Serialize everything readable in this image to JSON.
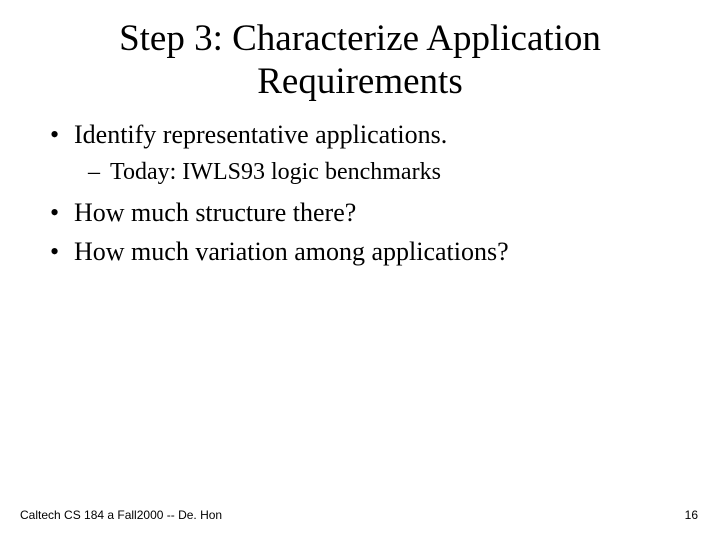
{
  "title": "Step 3: Characterize Application Requirements",
  "bullets": [
    {
      "text": "Identify representative applications.",
      "children": [
        {
          "text": "Today: IWLS93 logic benchmarks"
        }
      ]
    },
    {
      "text": "How much structure there?"
    },
    {
      "text": "How much variation among applications?"
    }
  ],
  "footer": {
    "left": "Caltech CS 184 a Fall2000 -- De. Hon",
    "right": "16"
  }
}
